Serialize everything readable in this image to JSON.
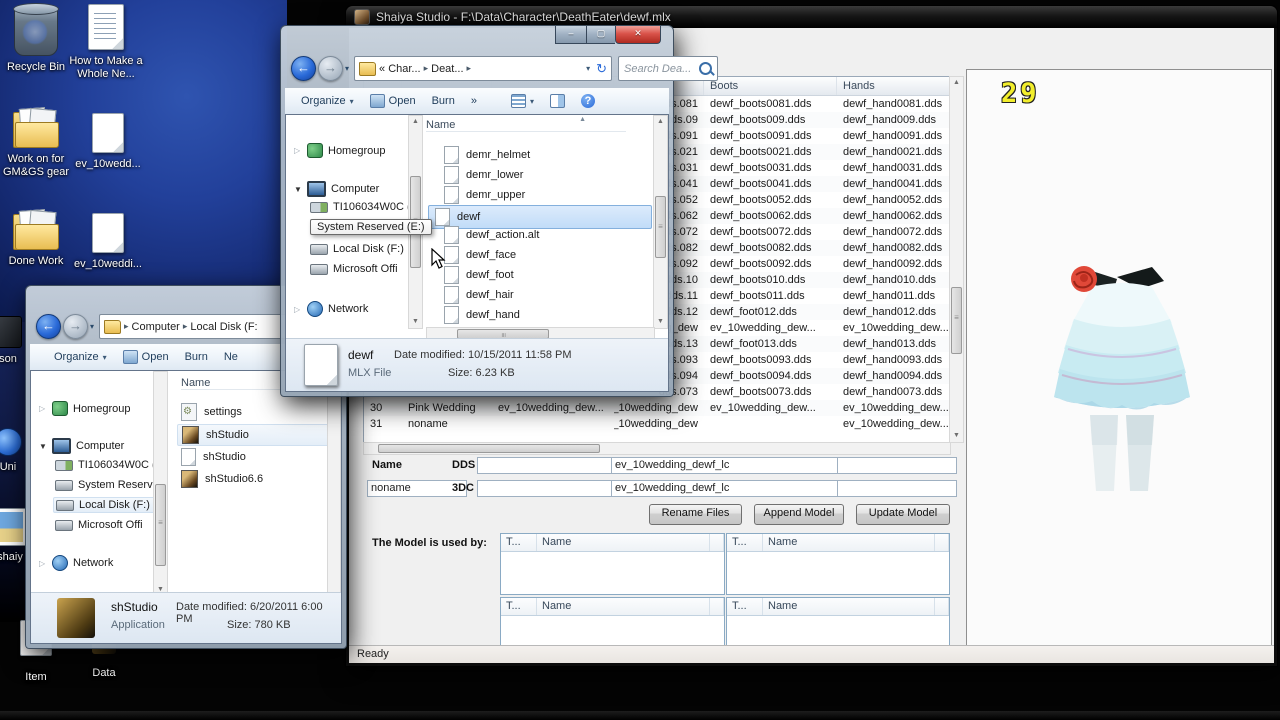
{
  "glyphs": {
    "caret": "▾",
    "sep": "▸",
    "chevrons": "»",
    "sort": "▲",
    "expander_open": "▼",
    "expander_closed": "▷",
    "back_arrow": "←",
    "fwd_arrow": "→",
    "refresh": "↻",
    "help": "?",
    "close": "✕",
    "minimize": "–",
    "maximize": "▢",
    "up": "▲",
    "down": "▼",
    "left": "◀",
    "right": "▶",
    "grip": "≡"
  },
  "desktop": {
    "icons": [
      {
        "label": "Recycle Bin"
      },
      {
        "label": "How to Make a Whole Ne..."
      },
      {
        "label": "Work on for GM&GS gear"
      },
      {
        "label": "ev_10wedd..."
      },
      {
        "label": "Done Work"
      },
      {
        "label": "ev_10weddi..."
      },
      {
        "label": "son"
      },
      {
        "label": "Uni"
      },
      {
        "label": "shaiy"
      },
      {
        "label": "Item"
      },
      {
        "label": "Data"
      }
    ]
  },
  "shaiya": {
    "title": "Shaiya Studio - F:\\Data\\Character\\DeathEater\\dewf.mlx",
    "preview_number": "29",
    "status": "Ready",
    "table": {
      "boots_header": "Boots",
      "hands_header": "Hands",
      "rows": [
        [
          "",
          "",
          "",
          "081.dds",
          "dewf_boots0081.dds",
          "dewf_hand0081.dds"
        ],
        [
          "",
          "",
          "",
          "09.dds",
          "dewf_boots009.dds",
          "dewf_hand009.dds"
        ],
        [
          "",
          "",
          "",
          "091.dds",
          "dewf_boots0091.dds",
          "dewf_hand0091.dds"
        ],
        [
          "",
          "",
          "",
          "021.dds",
          "dewf_boots0021.dds",
          "dewf_hand0021.dds"
        ],
        [
          "",
          "",
          "",
          "031.dds",
          "dewf_boots0031.dds",
          "dewf_hand0031.dds"
        ],
        [
          "",
          "",
          "",
          "041.dds",
          "dewf_boots0041.dds",
          "dewf_hand0041.dds"
        ],
        [
          "",
          "",
          "",
          "052.dds",
          "dewf_boots0052.dds",
          "dewf_hand0052.dds"
        ],
        [
          "",
          "",
          "",
          "062.dds",
          "dewf_boots0062.dds",
          "dewf_hand0062.dds"
        ],
        [
          "",
          "",
          "",
          "072.dds",
          "dewf_boots0072.dds",
          "dewf_hand0072.dds"
        ],
        [
          "",
          "",
          "",
          "082.dds",
          "dewf_boots0082.dds",
          "dewf_hand0082.dds"
        ],
        [
          "",
          "",
          "",
          "092.dds",
          "dewf_boots0092.dds",
          "dewf_hand0092.dds"
        ],
        [
          "",
          "",
          "",
          "10.dds",
          "dewf_boots010.dds",
          "dewf_hand010.dds"
        ],
        [
          "",
          "",
          "",
          "11.dds",
          "dewf_boots011.dds",
          "dewf_hand011.dds"
        ],
        [
          "",
          "",
          "",
          "12.dds",
          "dewf_foot012.dds",
          "dewf_hand012.dds"
        ],
        [
          "",
          "",
          "",
          "g_dew...",
          "ev_10wedding_dew...",
          "ev_10wedding_dew..."
        ],
        [
          "",
          "",
          "",
          "13.dds",
          "dewf_foot013.dds",
          "dewf_hand013.dds"
        ],
        [
          "",
          "",
          "",
          "093.dds",
          "dewf_boots0093.dds",
          "dewf_hand0093.dds"
        ],
        [
          "",
          "",
          "",
          "094.dds",
          "dewf_boots0094.dds",
          "dewf_hand0094.dds"
        ],
        [
          "",
          "",
          "",
          "073.dds",
          "dewf_boots0073.dds",
          "dewf_hand0073.dds"
        ],
        [
          "30",
          "Pink Wedding",
          "ev_10wedding_dew...",
          "ev_10wedding_dew...",
          "ev_10wedding_dew...",
          "ev_10wedding_dew..."
        ],
        [
          "31",
          "noname",
          "",
          "ev_10wedding_dew...",
          "",
          "ev_10wedding_dew..."
        ]
      ]
    },
    "form": {
      "name_label": "Name",
      "name_value": "noname",
      "dds_label": "DDS",
      "dds_value": "ev_10wedding_dewf_lc",
      "tdc_label": "3DC",
      "tdc_value": "ev_10wedding_dewf_lc"
    },
    "buttons": {
      "rename": "Rename Files",
      "append": "Append Model",
      "update": "Update Model"
    },
    "used_by": {
      "label": "The Model is used by:",
      "col_type": "T...",
      "col_name": "Name"
    }
  },
  "explorer1": {
    "crumbs": {
      "a": "« Char...",
      "b": "Deat..."
    },
    "search_placeholder": "Search Dea...",
    "toolbar": {
      "organize": "Organize",
      "open": "Open",
      "burn": "Burn"
    },
    "sidebar": {
      "homegroup": "Homegroup",
      "computer": "Computer",
      "drive_c": "TI106034W0C (",
      "drive_e": "System Reserved",
      "drive_f": "Local Disk (F:)",
      "drive_o": "Microsoft Offi",
      "network": "Network"
    },
    "tooltip": "System Reserved (E:)",
    "list_header": "Name",
    "files": [
      {
        "name": "demr_helmet"
      },
      {
        "name": "demr_lower"
      },
      {
        "name": "demr_upper"
      },
      {
        "name": "dewf"
      },
      {
        "name": "dewf_action.alt"
      },
      {
        "name": "dewf_face"
      },
      {
        "name": "dewf_foot"
      },
      {
        "name": "dewf_hair"
      },
      {
        "name": "dewf_hand"
      }
    ],
    "details": {
      "name": "dewf",
      "type": "MLX File",
      "modified": "Date modified: 10/15/2011 11:58 PM",
      "size": "Size: 6.23 KB"
    }
  },
  "explorer2": {
    "crumbs": {
      "a": "Computer",
      "b": "Local Disk (F:"
    },
    "toolbar": {
      "organize": "Organize",
      "open": "Open",
      "burn": "Burn",
      "more": "Ne"
    },
    "sidebar": {
      "homegroup": "Homegroup",
      "computer": "Computer",
      "drive_c": "TI106034W0C (",
      "drive_e": "System Reserv",
      "drive_f": "Local Disk (F:)",
      "drive_o": "Microsoft Offi",
      "network": "Network"
    },
    "list_header": "Name",
    "files": [
      {
        "name": "settings"
      },
      {
        "name": "shStudio"
      },
      {
        "name": "shStudio"
      },
      {
        "name": "shStudio6.6"
      }
    ],
    "details": {
      "name": "shStudio",
      "type": "Application",
      "modified": "Date modified: 6/20/2011 6:00 PM",
      "size": "Size: 780 KB"
    }
  }
}
